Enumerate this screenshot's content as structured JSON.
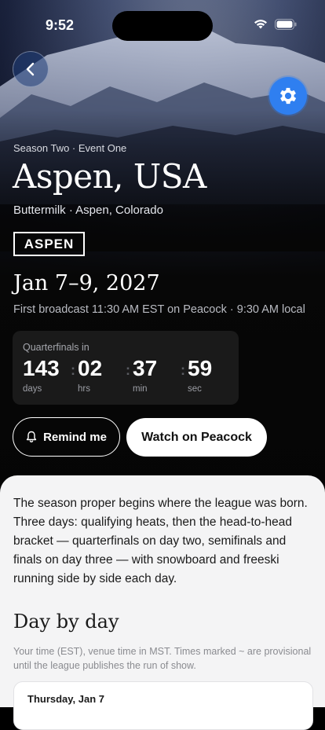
{
  "status_bar": {
    "time": "9:52"
  },
  "hero": {
    "eyebrow": "Season Two · Event One",
    "title": "Aspen, USA",
    "venue": "Buttermilk · Aspen, Colorado",
    "logo_text": "ASPEN",
    "dates": "Jan 7–9, 2027",
    "broadcast": "First broadcast 11:30 AM EST on Peacock · 9:30 AM local"
  },
  "countdown": {
    "label": "Quarterfinals in",
    "units": [
      {
        "value": "143",
        "unit": "days"
      },
      {
        "value": "02",
        "unit": "hrs"
      },
      {
        "value": "37",
        "unit": "min"
      },
      {
        "value": "59",
        "unit": "sec"
      }
    ]
  },
  "actions": {
    "remind_label": "Remind me",
    "watch_label": "Watch on Peacock"
  },
  "content": {
    "intro": "The season proper begins where the league was born. Three days: qualifying heats, then the head-to-head bracket — quarterfinals on day two, semifinals and finals on day three — with snowboard and freeski running side by side each day.",
    "section_title": "Day by day",
    "section_note": "Your time (EST), venue time in MST. Times marked ~ are provisional until the league publishes the run of show.",
    "days": [
      {
        "label": "Thursday, Jan 7"
      }
    ]
  },
  "colors": {
    "accent": "#2f7ff0",
    "sheet": "#f4f4f5",
    "card": "#1a1a1a"
  },
  "icons": [
    "back-chevron-icon",
    "gear-icon",
    "bell-icon",
    "signal-icon",
    "wifi-icon",
    "battery-icon"
  ]
}
